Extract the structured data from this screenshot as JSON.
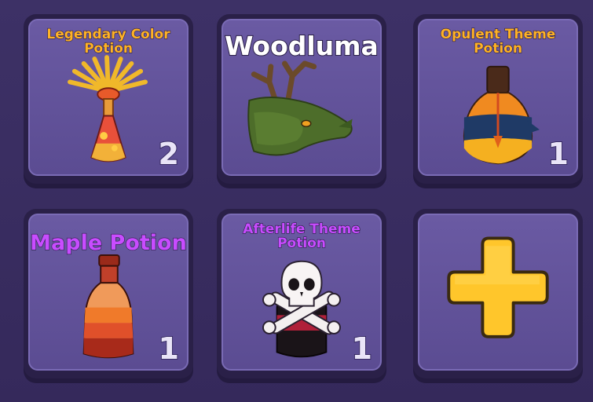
{
  "items": [
    {
      "title": "Legendary Color Potion",
      "count": "2",
      "icon": "legendary-color-potion-icon"
    },
    {
      "title": "Woodluma",
      "count": "",
      "icon": "woodluma-deer-icon"
    },
    {
      "title": "Opulent Theme Potion",
      "count": "1",
      "icon": "opulent-theme-potion-icon"
    },
    {
      "title": "Maple Potion",
      "count": "1",
      "icon": "maple-potion-icon"
    },
    {
      "title": "Afterlife Theme Potion",
      "count": "1",
      "icon": "afterlife-theme-potion-icon"
    }
  ],
  "add_slot": {
    "icon": "plus-icon"
  },
  "colors": {
    "title_orange": "#ffb226",
    "title_purple": "#c84cff",
    "plus_yellow": "#ffc62b"
  }
}
